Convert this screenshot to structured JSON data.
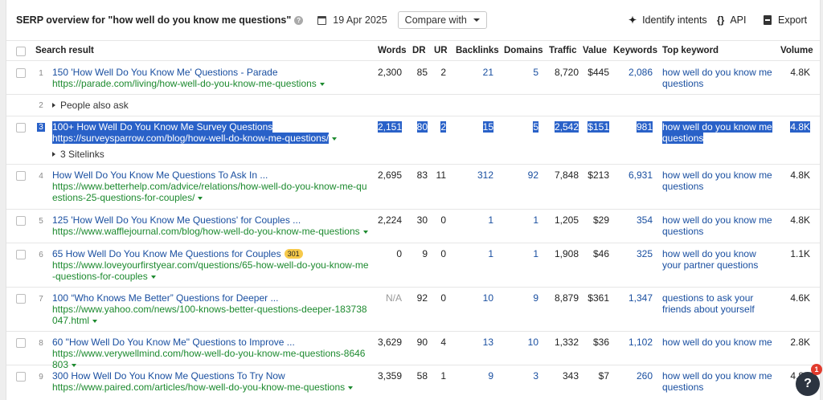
{
  "header": {
    "title": "SERP overview for \"how well do you know me questions\"",
    "help_glyph": "?",
    "date": "19 Apr 2025",
    "compare_label": "Compare with",
    "identify_intents": "Identify intents",
    "api": "API",
    "export": "Export"
  },
  "columns": {
    "search_result": "Search result",
    "words": "Words",
    "dr": "DR",
    "ur": "UR",
    "backlinks": "Backlinks",
    "domains": "Domains",
    "traffic": "Traffic",
    "value": "Value",
    "keywords": "Keywords",
    "top_keyword": "Top keyword",
    "volume": "Volume"
  },
  "rows": [
    {
      "num": "1",
      "title": "150 'How Well Do You Know Me' Questions - Parade",
      "url": "https://parade.com/living/how-well-do-you-know-me-questions",
      "words": "2,300",
      "dr": "85",
      "ur": "2",
      "backlinks": "21",
      "domains": "5",
      "traffic": "8,720",
      "value": "$445",
      "keywords": "2,086",
      "top_keyword": "how well do you know me questions",
      "volume": "4.8K"
    },
    {
      "num": "2",
      "paa": "People also ask"
    },
    {
      "num": "3",
      "title": "100+ How Well Do You Know Me Survey Questions",
      "url": "https://surveysparrow.com/blog/how-well-do-know-me-questions/",
      "sitelinks": "3 Sitelinks",
      "words": "2,151",
      "dr": "80",
      "ur": "2",
      "backlinks": "15",
      "domains": "5",
      "traffic": "2,542",
      "value": "$151",
      "keywords": "981",
      "top_keyword": "how well do you know me questions",
      "volume": "4.8K"
    },
    {
      "num": "4",
      "title": "How Well Do You Know Me Questions To Ask In ...",
      "url": "https://www.betterhelp.com/advice/relations/how-well-do-you-know-me-questions-25-questions-for-couples/",
      "words": "2,695",
      "dr": "83",
      "ur": "11",
      "backlinks": "312",
      "domains": "92",
      "traffic": "7,848",
      "value": "$213",
      "keywords": "6,931",
      "top_keyword": "how well do you know me questions",
      "volume": "4.8K"
    },
    {
      "num": "5",
      "title": "125 'How Well Do You Know Me Questions' for Couples ...",
      "url": "https://www.wafflejournal.com/blog/how-well-do-you-know-me-questions",
      "words": "2,224",
      "dr": "30",
      "ur": "0",
      "backlinks": "1",
      "domains": "1",
      "traffic": "1,205",
      "value": "$29",
      "keywords": "354",
      "top_keyword": "how well do you know me questions",
      "volume": "4.8K"
    },
    {
      "num": "6",
      "title": "65 How Well Do You Know Me Questions for Couples",
      "badge": "301",
      "url": "https://www.loveyourfirstyear.com/questions/65-how-well-do-you-know-me-questions-for-couples",
      "words": "0",
      "dr": "9",
      "ur": "0",
      "backlinks": "1",
      "domains": "1",
      "traffic": "1,908",
      "value": "$46",
      "keywords": "325",
      "top_keyword": "how well do you know your partner questions",
      "volume": "1.1K"
    },
    {
      "num": "7",
      "title": "100 “Who Knows Me Better” Questions for Deeper ...",
      "url": "https://www.yahoo.com/news/100-knows-better-questions-deeper-183738047.html",
      "words": "N/A",
      "dr": "92",
      "ur": "0",
      "backlinks": "10",
      "domains": "9",
      "traffic": "8,879",
      "value": "$361",
      "keywords": "1,347",
      "top_keyword": "questions to ask your friends about yourself",
      "volume": "4.6K"
    },
    {
      "num": "8",
      "title": "60 \"How Well Do You Know Me\" Questions to Improve ...",
      "url": "https://www.verywellmind.com/how-well-do-you-know-me-questions-8646803",
      "words": "3,629",
      "dr": "90",
      "ur": "4",
      "backlinks": "13",
      "domains": "10",
      "traffic": "1,332",
      "value": "$36",
      "keywords": "1,102",
      "top_keyword": "how well do you know me",
      "volume": "2.8K"
    },
    {
      "num": "9",
      "title": "300 How Well Do You Know Me Questions To Try Now",
      "url": "https://www.paired.com/articles/how-well-do-you-know-me-questions",
      "words": "3,359",
      "dr": "58",
      "ur": "1",
      "backlinks": "9",
      "domains": "3",
      "traffic": "343",
      "value": "$7",
      "keywords": "260",
      "top_keyword": "how well do you know me questions",
      "volume": "4.8K"
    }
  ],
  "help_button": "?",
  "notification_count": "1"
}
